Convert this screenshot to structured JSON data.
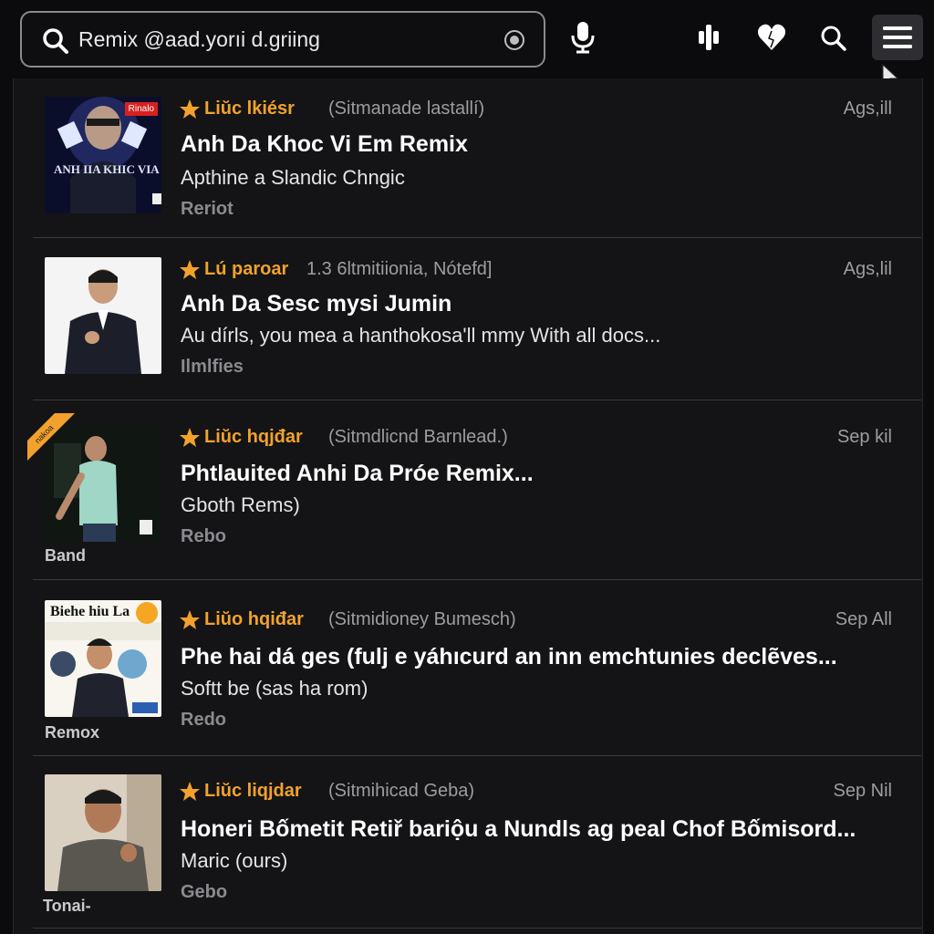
{
  "search": {
    "value": "Remix @aad.yorıi d.griing"
  },
  "toolbar": {
    "icons": [
      "search-icon",
      "clear-icon",
      "mic-icon",
      "equalizer-icon",
      "heart-icon",
      "search-icon",
      "menu-icon"
    ]
  },
  "results": [
    {
      "artist": "Liŭc lkiésr",
      "meta": "(Sitmanade lastallí)",
      "date": "Ags,ill",
      "title": "Anh Da Khoc Vi Em Remix",
      "subtitle": "Apthine a Slandic Chngic",
      "tag": "Reriot",
      "thumb_text": "ANH IIA KHIC VIA",
      "thumb_badge": "Rinalo",
      "caption": ""
    },
    {
      "artist": "Lú paroar",
      "meta": "1.3 6ltmitiionia, Nótefd]",
      "date": "Ags,lil",
      "title": "Anh Da Sesc mysi Jumin",
      "subtitle": "Au dírls, you mea a hanthokosa'll mmy With all docs...",
      "tag": "Ilmlfies",
      "caption": ""
    },
    {
      "artist": "Liŭc hqjđar",
      "meta": "(Sitmdlicnd Barnlead.)",
      "date": "Sep kil",
      "title": "Phtlauited Anhi Da Próe Remix...",
      "subtitle": "Gboth Rems)",
      "tag": "Rebo",
      "caption": "Band",
      "corner": "nakoa"
    },
    {
      "artist": "Liŭo hqiđar",
      "meta": "(Sitmidioney Bumesch)",
      "date": "Sep All",
      "title": "Phe hai dá ges (fulj e yáhıcurd an inn emchtunies declẽves...",
      "subtitle": "Softt be (sas ha rom)",
      "tag": "Redo",
      "caption": "Remox",
      "thumb_text": "Biehe hiu La"
    },
    {
      "artist": "Liŭc liqjdar",
      "meta": "(Sitmihicad Geba)",
      "date": "Sep Nil",
      "title": "Honeri Bốmetit Retiř bariộu a Nundls ag peal Chof Bốmisord...",
      "subtitle": "Maric (ours)",
      "tag": "Gebo",
      "caption": "Tonai-"
    }
  ],
  "colors": {
    "accent": "#f2a22c",
    "bg": "#141416",
    "divider": "#3a3a3e"
  }
}
